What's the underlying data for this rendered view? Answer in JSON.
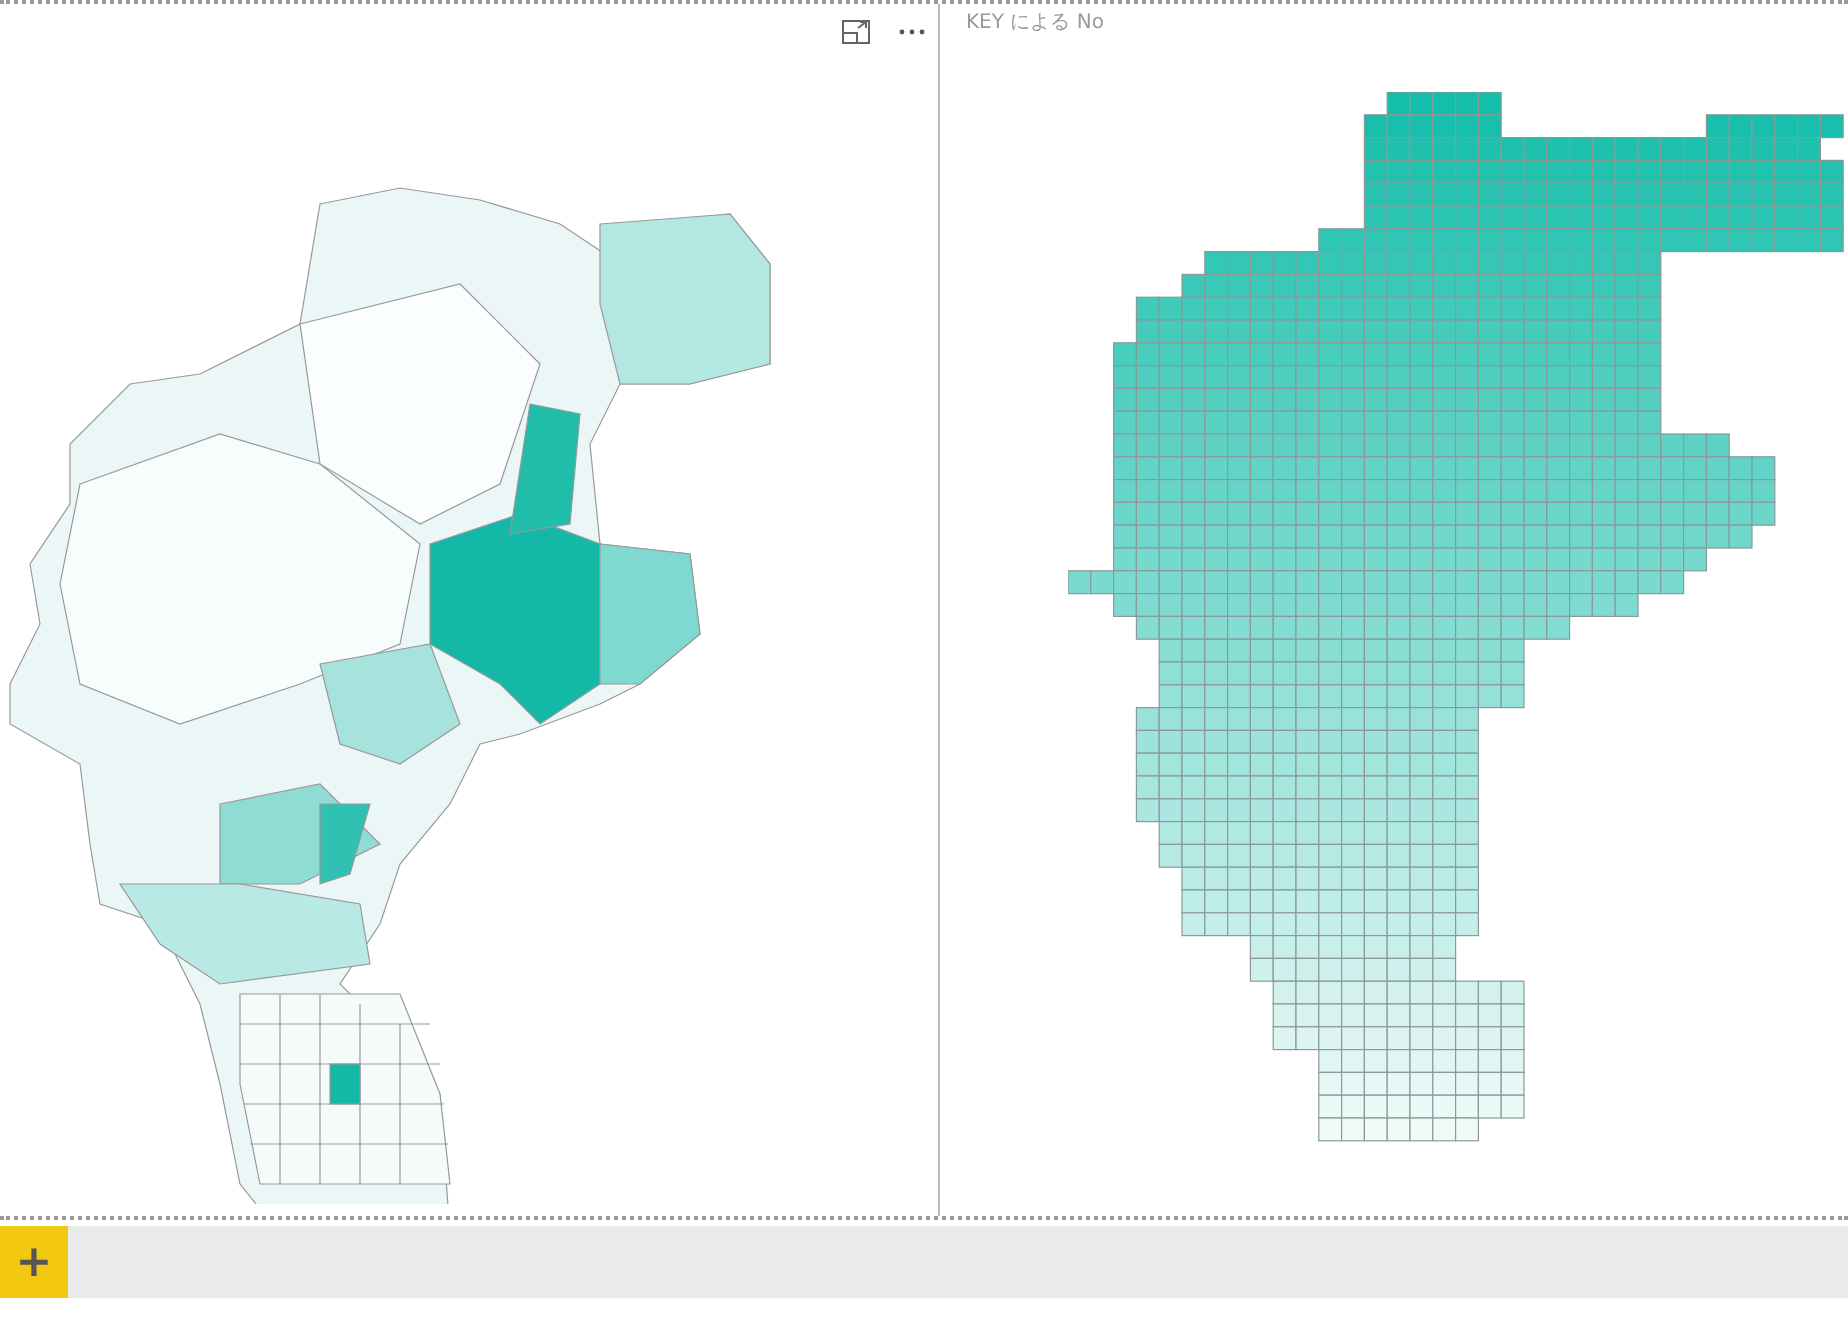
{
  "right_visual": {
    "title": "KEY による No"
  },
  "add_page_button": {
    "label": "+"
  }
}
